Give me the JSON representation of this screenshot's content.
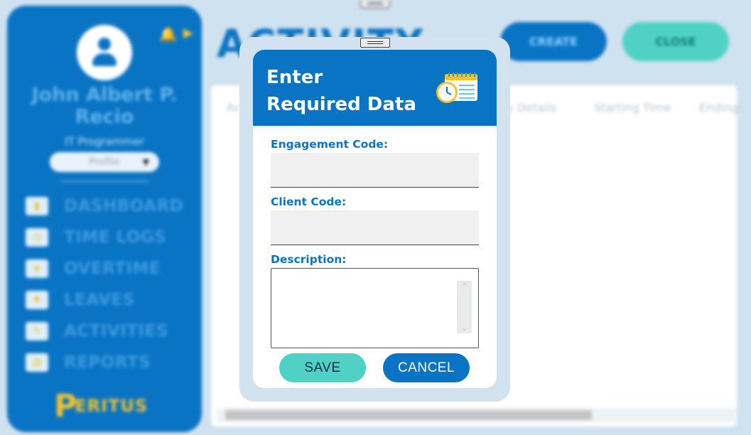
{
  "sidebar": {
    "user_name": "John Albert P. Recio",
    "user_role": "IT Programmer",
    "profile_select": "Profile",
    "items": [
      {
        "label": "DASHBOARD",
        "icon": "chart-icon"
      },
      {
        "label": "TIME LOGS",
        "icon": "clock-icon"
      },
      {
        "label": "OVERTIME",
        "icon": "overtime-icon"
      },
      {
        "label": "LEAVES",
        "icon": "leaves-icon"
      },
      {
        "label": "ACTIVITIES",
        "icon": "activities-icon"
      },
      {
        "label": "REPORTS",
        "icon": "reports-icon"
      }
    ],
    "brand": "ERITUS"
  },
  "header": {
    "title": "ACTIVITY",
    "create_label": "CREATE",
    "close_label": "CLOSE"
  },
  "table": {
    "columns": [
      "Ac",
      "ty Details",
      "Starting Time",
      "Ending"
    ]
  },
  "modal": {
    "title_line1": "Enter",
    "title_line2": "Required Data",
    "engagement_label": "Engagement Code:",
    "engagement_value": "",
    "client_label": "Client Code:",
    "client_value": "",
    "description_label": "Description:",
    "description_value": "",
    "save_label": "SAVE",
    "cancel_label": "CANCEL"
  },
  "colors": {
    "primary": "#0a74c4",
    "accent": "#4fd2c5",
    "highlight": "#f2c12e"
  }
}
